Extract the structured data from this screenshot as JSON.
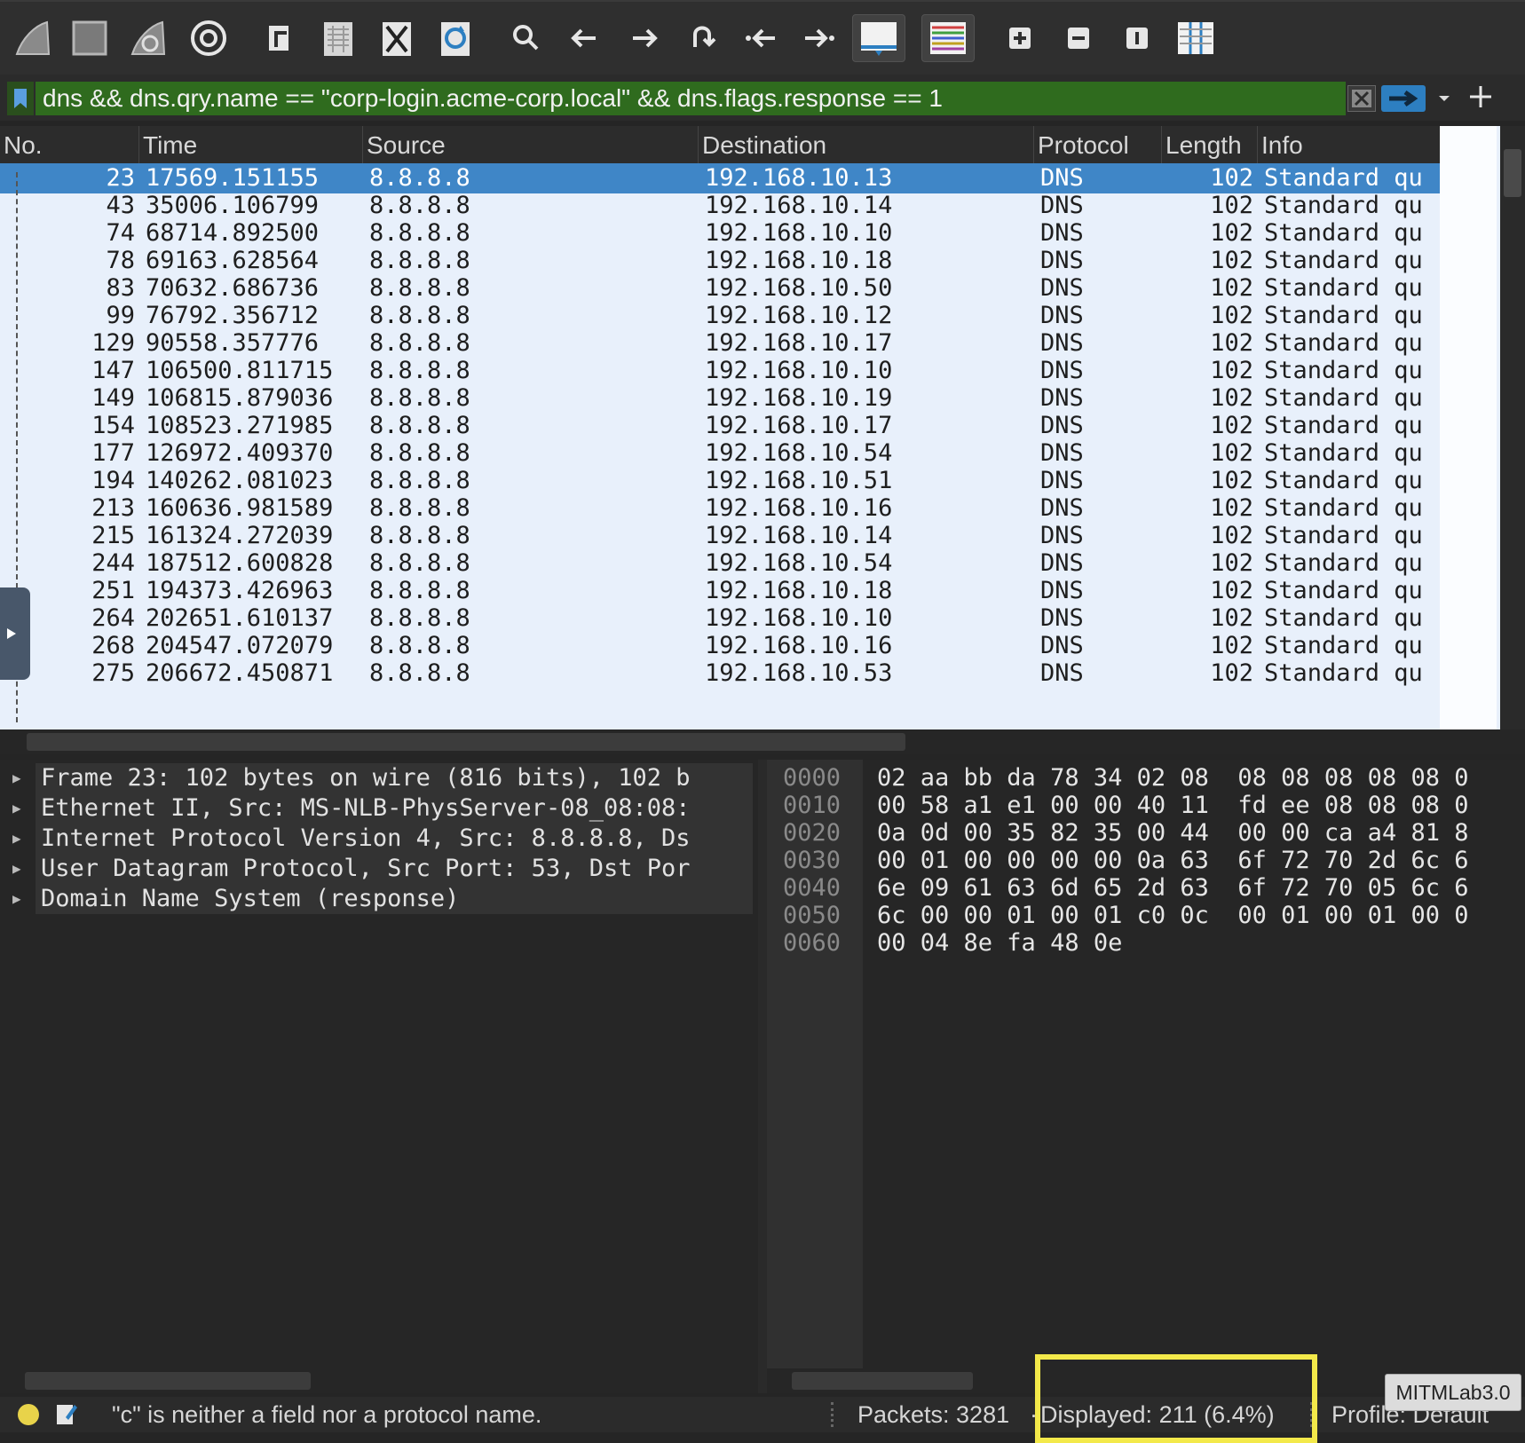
{
  "toolbar": {
    "buttons": [
      "start-capture",
      "stop-capture",
      "restart-capture",
      "capture-options",
      "open-file",
      "save-file",
      "close-file",
      "reload-file",
      "find-packet",
      "go-back",
      "go-forward",
      "go-to-packet",
      "go-first",
      "go-last",
      "autoscroll",
      "colorize",
      "zoom-in",
      "zoom-out",
      "normal-size",
      "resize-columns"
    ]
  },
  "filter": {
    "value": "dns && dns.qry.name == \"corp-login.acme-corp.local\" && dns.flags.response == 1",
    "color": "#2f6b1e"
  },
  "packet_list": {
    "columns": [
      "No.",
      "Time",
      "Source",
      "Destination",
      "Protocol",
      "Length",
      "Info"
    ],
    "selected_color": "#3f86c7",
    "row_color": "#e8f0fb",
    "rows": [
      {
        "no": "23",
        "time": "17569.151155",
        "src": "8.8.8.8",
        "dst": "192.168.10.13",
        "proto": "DNS",
        "len": "102",
        "info": "Standard qu"
      },
      {
        "no": "43",
        "time": "35006.106799",
        "src": "8.8.8.8",
        "dst": "192.168.10.14",
        "proto": "DNS",
        "len": "102",
        "info": "Standard qu"
      },
      {
        "no": "74",
        "time": "68714.892500",
        "src": "8.8.8.8",
        "dst": "192.168.10.10",
        "proto": "DNS",
        "len": "102",
        "info": "Standard qu"
      },
      {
        "no": "78",
        "time": "69163.628564",
        "src": "8.8.8.8",
        "dst": "192.168.10.18",
        "proto": "DNS",
        "len": "102",
        "info": "Standard qu"
      },
      {
        "no": "83",
        "time": "70632.686736",
        "src": "8.8.8.8",
        "dst": "192.168.10.50",
        "proto": "DNS",
        "len": "102",
        "info": "Standard qu"
      },
      {
        "no": "99",
        "time": "76792.356712",
        "src": "8.8.8.8",
        "dst": "192.168.10.12",
        "proto": "DNS",
        "len": "102",
        "info": "Standard qu"
      },
      {
        "no": "129",
        "time": "90558.357776",
        "src": "8.8.8.8",
        "dst": "192.168.10.17",
        "proto": "DNS",
        "len": "102",
        "info": "Standard qu"
      },
      {
        "no": "147",
        "time": "106500.811715",
        "src": "8.8.8.8",
        "dst": "192.168.10.10",
        "proto": "DNS",
        "len": "102",
        "info": "Standard qu"
      },
      {
        "no": "149",
        "time": "106815.879036",
        "src": "8.8.8.8",
        "dst": "192.168.10.19",
        "proto": "DNS",
        "len": "102",
        "info": "Standard qu"
      },
      {
        "no": "154",
        "time": "108523.271985",
        "src": "8.8.8.8",
        "dst": "192.168.10.17",
        "proto": "DNS",
        "len": "102",
        "info": "Standard qu"
      },
      {
        "no": "177",
        "time": "126972.409370",
        "src": "8.8.8.8",
        "dst": "192.168.10.54",
        "proto": "DNS",
        "len": "102",
        "info": "Standard qu"
      },
      {
        "no": "194",
        "time": "140262.081023",
        "src": "8.8.8.8",
        "dst": "192.168.10.51",
        "proto": "DNS",
        "len": "102",
        "info": "Standard qu"
      },
      {
        "no": "213",
        "time": "160636.981589",
        "src": "8.8.8.8",
        "dst": "192.168.10.16",
        "proto": "DNS",
        "len": "102",
        "info": "Standard qu"
      },
      {
        "no": "215",
        "time": "161324.272039",
        "src": "8.8.8.8",
        "dst": "192.168.10.14",
        "proto": "DNS",
        "len": "102",
        "info": "Standard qu"
      },
      {
        "no": "244",
        "time": "187512.600828",
        "src": "8.8.8.8",
        "dst": "192.168.10.54",
        "proto": "DNS",
        "len": "102",
        "info": "Standard qu"
      },
      {
        "no": "251",
        "time": "194373.426963",
        "src": "8.8.8.8",
        "dst": "192.168.10.18",
        "proto": "DNS",
        "len": "102",
        "info": "Standard qu"
      },
      {
        "no": "264",
        "time": "202651.610137",
        "src": "8.8.8.8",
        "dst": "192.168.10.10",
        "proto": "DNS",
        "len": "102",
        "info": "Standard qu"
      },
      {
        "no": "268",
        "time": "204547.072079",
        "src": "8.8.8.8",
        "dst": "192.168.10.16",
        "proto": "DNS",
        "len": "102",
        "info": "Standard qu"
      },
      {
        "no": "275",
        "time": "206672.450871",
        "src": "8.8.8.8",
        "dst": "192.168.10.53",
        "proto": "DNS",
        "len": "102",
        "info": "Standard qu"
      }
    ]
  },
  "details": {
    "items": [
      "Frame 23: 102 bytes on wire (816 bits), 102 b",
      "Ethernet II, Src: MS-NLB-PhysServer-08_08:08:",
      "Internet Protocol Version 4, Src: 8.8.8.8, Ds",
      "User Datagram Protocol, Src Port: 53, Dst Por",
      "Domain Name System (response)"
    ]
  },
  "bytes": {
    "rows": [
      {
        "offset": "0000",
        "hex": "02 aa bb da 78 34 02 08  08 08 08 08 08 0"
      },
      {
        "offset": "0010",
        "hex": "00 58 a1 e1 00 00 40 11  fd ee 08 08 08 0"
      },
      {
        "offset": "0020",
        "hex": "0a 0d 00 35 82 35 00 44  00 00 ca a4 81 8"
      },
      {
        "offset": "0030",
        "hex": "00 01 00 00 00 00 0a 63  6f 72 70 2d 6c 6"
      },
      {
        "offset": "0040",
        "hex": "6e 09 61 63 6d 65 2d 63  6f 72 70 05 6c 6"
      },
      {
        "offset": "0050",
        "hex": "6c 00 00 01 00 01 c0 0c  00 01 00 01 00 0"
      },
      {
        "offset": "0060",
        "hex": "00 04 8e fa 48 0e"
      }
    ]
  },
  "status": {
    "message": "\"c\" is neither a field nor a protocol name.",
    "packets": "Packets: 3281",
    "separator": "·",
    "displayed": "Displayed: 211 (6.4%)",
    "profile": "Profile: Default",
    "highlight_color": "#f3e94a"
  },
  "watermark": "MITMLab3.0"
}
